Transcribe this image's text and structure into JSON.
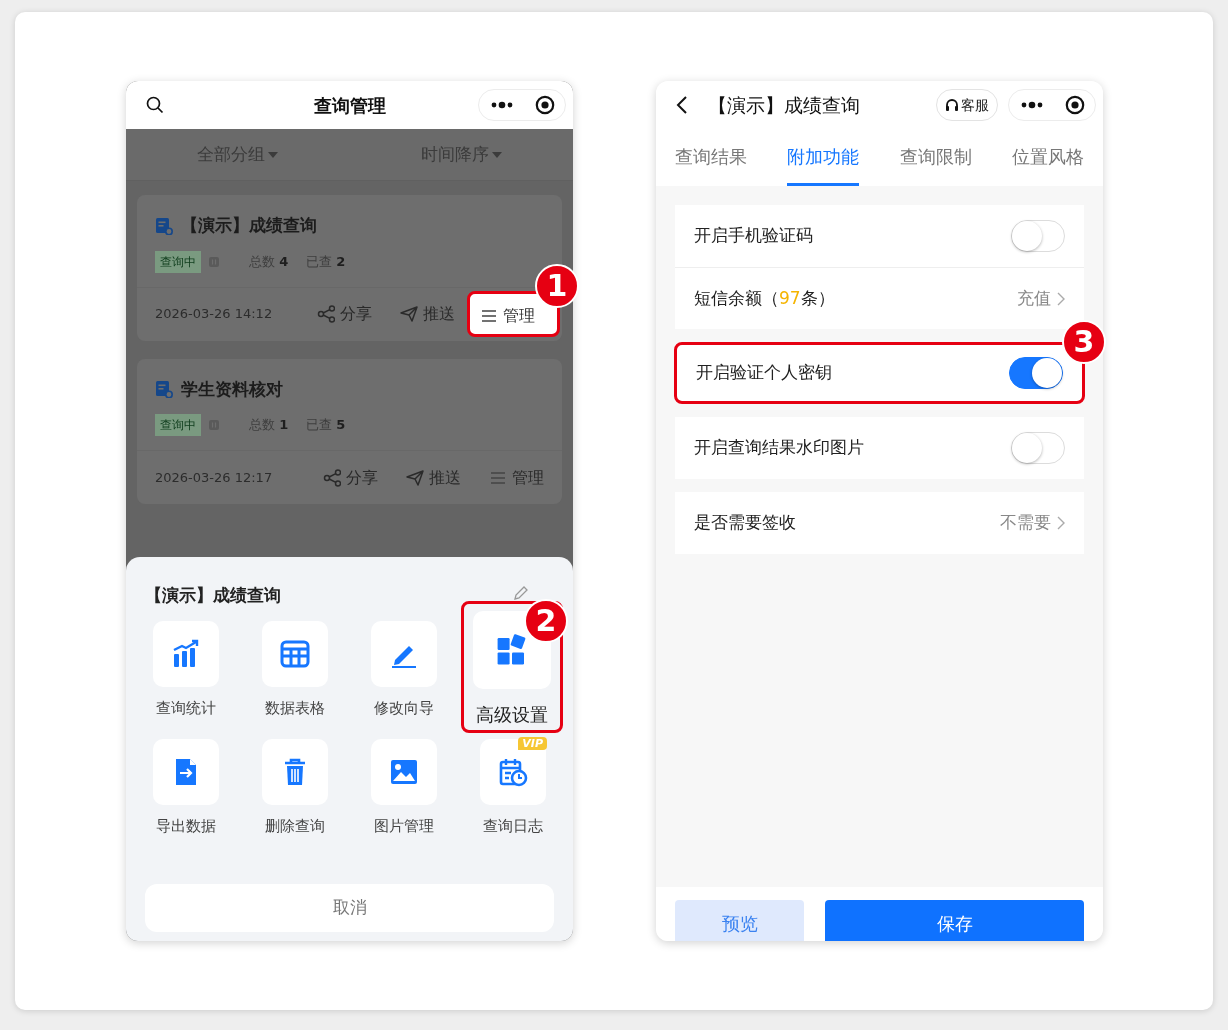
{
  "left_phone": {
    "title": "查询管理",
    "filters": [
      {
        "label": "全部分组"
      },
      {
        "label": "时间降序"
      }
    ],
    "cards": [
      {
        "title": "【演示】成绩查询",
        "status": "查询中",
        "stats": [
          {
            "label": "总数",
            "value": "4"
          },
          {
            "label": "已查",
            "value": "2"
          }
        ],
        "date": "2026-03-26 14:12",
        "actions": [
          {
            "label": "分享"
          },
          {
            "label": "推送"
          },
          {
            "label": "管理",
            "callout": "1"
          }
        ]
      },
      {
        "title": "学生资料核对",
        "status": "查询中",
        "stats": [
          {
            "label": "总数",
            "value": "1"
          },
          {
            "label": "已查",
            "value": "5"
          }
        ],
        "date": "2026-03-26 12:17",
        "actions": [
          {
            "label": "分享"
          },
          {
            "label": "推送"
          },
          {
            "label": "管理"
          }
        ]
      }
    ],
    "sheet": {
      "title": "【演示】成绩查询",
      "items": [
        {
          "label": "查询统计"
        },
        {
          "label": "数据表格"
        },
        {
          "label": "修改向导"
        },
        {
          "label": "高级设置",
          "callout": "2"
        },
        {
          "label": "导出数据"
        },
        {
          "label": "删除查询"
        },
        {
          "label": "图片管理"
        },
        {
          "label": "查询日志",
          "badge": "VIP"
        }
      ],
      "cancel": "取消"
    }
  },
  "right_phone": {
    "title": "【演示】成绩查询",
    "service_button": "客服",
    "tabs": [
      {
        "label": "查询结果",
        "selected": false
      },
      {
        "label": "附加功能",
        "selected": true
      },
      {
        "label": "查询限制",
        "selected": false
      },
      {
        "label": "位置风格",
        "selected": false
      }
    ],
    "groups": [
      {
        "rows": [
          {
            "kind": "toggle",
            "label": "开启手机验证码",
            "on": false
          },
          {
            "kind": "link",
            "label": "短信余额（",
            "count": "97",
            "label_end": "条）",
            "value": "充值"
          }
        ]
      },
      {
        "callout": "3",
        "rows": [
          {
            "kind": "toggle",
            "label": "开启验证个人密钥",
            "on": true
          }
        ]
      },
      {
        "rows": [
          {
            "kind": "toggle",
            "label": "开启查询结果水印图片",
            "on": false
          }
        ]
      },
      {
        "rows": [
          {
            "kind": "link",
            "label": "是否需要签收",
            "value": "不需要"
          }
        ]
      }
    ],
    "buttons": [
      {
        "kind": "secondary",
        "label": "预览"
      },
      {
        "kind": "primary",
        "label": "保存"
      }
    ]
  }
}
